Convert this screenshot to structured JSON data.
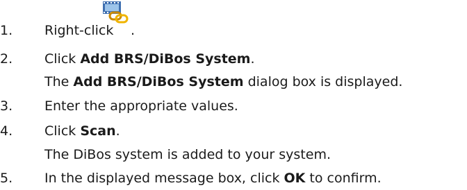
{
  "steps": [
    {
      "num": "1.",
      "pre": "Right-click ",
      "icon": "video-link-device-icon",
      "post": "."
    },
    {
      "num": "2.",
      "pre": "Click ",
      "bold": "Add BRS/DiBos System",
      "post": "."
    },
    {
      "pre": "The ",
      "bold": "Add BRS/DiBos System",
      "post": " dialog box is displayed."
    },
    {
      "num": "3.",
      "pre": "Enter the appropriate values."
    },
    {
      "num": "4.",
      "pre": "Click ",
      "bold": "Scan",
      "post": "."
    },
    {
      "pre": "The DiBos system is added to your system."
    },
    {
      "num": "5.",
      "pre": "In the displayed message box, click ",
      "bold": "OK",
      "post": " to confirm."
    }
  ]
}
